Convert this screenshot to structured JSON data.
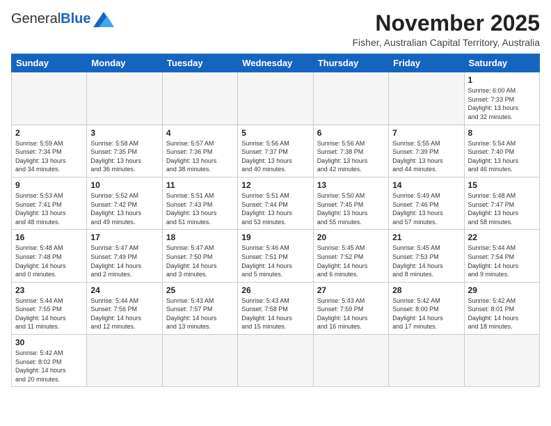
{
  "logo": {
    "general": "General",
    "blue": "Blue"
  },
  "title": "November 2025",
  "location": "Fisher, Australian Capital Territory, Australia",
  "days_of_week": [
    "Sunday",
    "Monday",
    "Tuesday",
    "Wednesday",
    "Thursday",
    "Friday",
    "Saturday"
  ],
  "weeks": [
    [
      {
        "day": "",
        "info": ""
      },
      {
        "day": "",
        "info": ""
      },
      {
        "day": "",
        "info": ""
      },
      {
        "day": "",
        "info": ""
      },
      {
        "day": "",
        "info": ""
      },
      {
        "day": "",
        "info": ""
      },
      {
        "day": "1",
        "info": "Sunrise: 6:00 AM\nSunset: 7:33 PM\nDaylight: 13 hours\nand 32 minutes."
      }
    ],
    [
      {
        "day": "2",
        "info": "Sunrise: 5:59 AM\nSunset: 7:34 PM\nDaylight: 13 hours\nand 34 minutes."
      },
      {
        "day": "3",
        "info": "Sunrise: 5:58 AM\nSunset: 7:35 PM\nDaylight: 13 hours\nand 36 minutes."
      },
      {
        "day": "4",
        "info": "Sunrise: 5:57 AM\nSunset: 7:36 PM\nDaylight: 13 hours\nand 38 minutes."
      },
      {
        "day": "5",
        "info": "Sunrise: 5:56 AM\nSunset: 7:37 PM\nDaylight: 13 hours\nand 40 minutes."
      },
      {
        "day": "6",
        "info": "Sunrise: 5:56 AM\nSunset: 7:38 PM\nDaylight: 13 hours\nand 42 minutes."
      },
      {
        "day": "7",
        "info": "Sunrise: 5:55 AM\nSunset: 7:39 PM\nDaylight: 13 hours\nand 44 minutes."
      },
      {
        "day": "8",
        "info": "Sunrise: 5:54 AM\nSunset: 7:40 PM\nDaylight: 13 hours\nand 46 minutes."
      }
    ],
    [
      {
        "day": "9",
        "info": "Sunrise: 5:53 AM\nSunset: 7:41 PM\nDaylight: 13 hours\nand 48 minutes."
      },
      {
        "day": "10",
        "info": "Sunrise: 5:52 AM\nSunset: 7:42 PM\nDaylight: 13 hours\nand 49 minutes."
      },
      {
        "day": "11",
        "info": "Sunrise: 5:51 AM\nSunset: 7:43 PM\nDaylight: 13 hours\nand 51 minutes."
      },
      {
        "day": "12",
        "info": "Sunrise: 5:51 AM\nSunset: 7:44 PM\nDaylight: 13 hours\nand 53 minutes."
      },
      {
        "day": "13",
        "info": "Sunrise: 5:50 AM\nSunset: 7:45 PM\nDaylight: 13 hours\nand 55 minutes."
      },
      {
        "day": "14",
        "info": "Sunrise: 5:49 AM\nSunset: 7:46 PM\nDaylight: 13 hours\nand 57 minutes."
      },
      {
        "day": "15",
        "info": "Sunrise: 5:48 AM\nSunset: 7:47 PM\nDaylight: 13 hours\nand 58 minutes."
      }
    ],
    [
      {
        "day": "16",
        "info": "Sunrise: 5:48 AM\nSunset: 7:48 PM\nDaylight: 14 hours\nand 0 minutes."
      },
      {
        "day": "17",
        "info": "Sunrise: 5:47 AM\nSunset: 7:49 PM\nDaylight: 14 hours\nand 2 minutes."
      },
      {
        "day": "18",
        "info": "Sunrise: 5:47 AM\nSunset: 7:50 PM\nDaylight: 14 hours\nand 3 minutes."
      },
      {
        "day": "19",
        "info": "Sunrise: 5:46 AM\nSunset: 7:51 PM\nDaylight: 14 hours\nand 5 minutes."
      },
      {
        "day": "20",
        "info": "Sunrise: 5:45 AM\nSunset: 7:52 PM\nDaylight: 14 hours\nand 6 minutes."
      },
      {
        "day": "21",
        "info": "Sunrise: 5:45 AM\nSunset: 7:53 PM\nDaylight: 14 hours\nand 8 minutes."
      },
      {
        "day": "22",
        "info": "Sunrise: 5:44 AM\nSunset: 7:54 PM\nDaylight: 14 hours\nand 9 minutes."
      }
    ],
    [
      {
        "day": "23",
        "info": "Sunrise: 5:44 AM\nSunset: 7:55 PM\nDaylight: 14 hours\nand 11 minutes."
      },
      {
        "day": "24",
        "info": "Sunrise: 5:44 AM\nSunset: 7:56 PM\nDaylight: 14 hours\nand 12 minutes."
      },
      {
        "day": "25",
        "info": "Sunrise: 5:43 AM\nSunset: 7:57 PM\nDaylight: 14 hours\nand 13 minutes."
      },
      {
        "day": "26",
        "info": "Sunrise: 5:43 AM\nSunset: 7:58 PM\nDaylight: 14 hours\nand 15 minutes."
      },
      {
        "day": "27",
        "info": "Sunrise: 5:43 AM\nSunset: 7:59 PM\nDaylight: 14 hours\nand 16 minutes."
      },
      {
        "day": "28",
        "info": "Sunrise: 5:42 AM\nSunset: 8:00 PM\nDaylight: 14 hours\nand 17 minutes."
      },
      {
        "day": "29",
        "info": "Sunrise: 5:42 AM\nSunset: 8:01 PM\nDaylight: 14 hours\nand 18 minutes."
      }
    ],
    [
      {
        "day": "30",
        "info": "Sunrise: 5:42 AM\nSunset: 8:02 PM\nDaylight: 14 hours\nand 20 minutes."
      },
      {
        "day": "",
        "info": ""
      },
      {
        "day": "",
        "info": ""
      },
      {
        "day": "",
        "info": ""
      },
      {
        "day": "",
        "info": ""
      },
      {
        "day": "",
        "info": ""
      },
      {
        "day": "",
        "info": ""
      }
    ]
  ]
}
